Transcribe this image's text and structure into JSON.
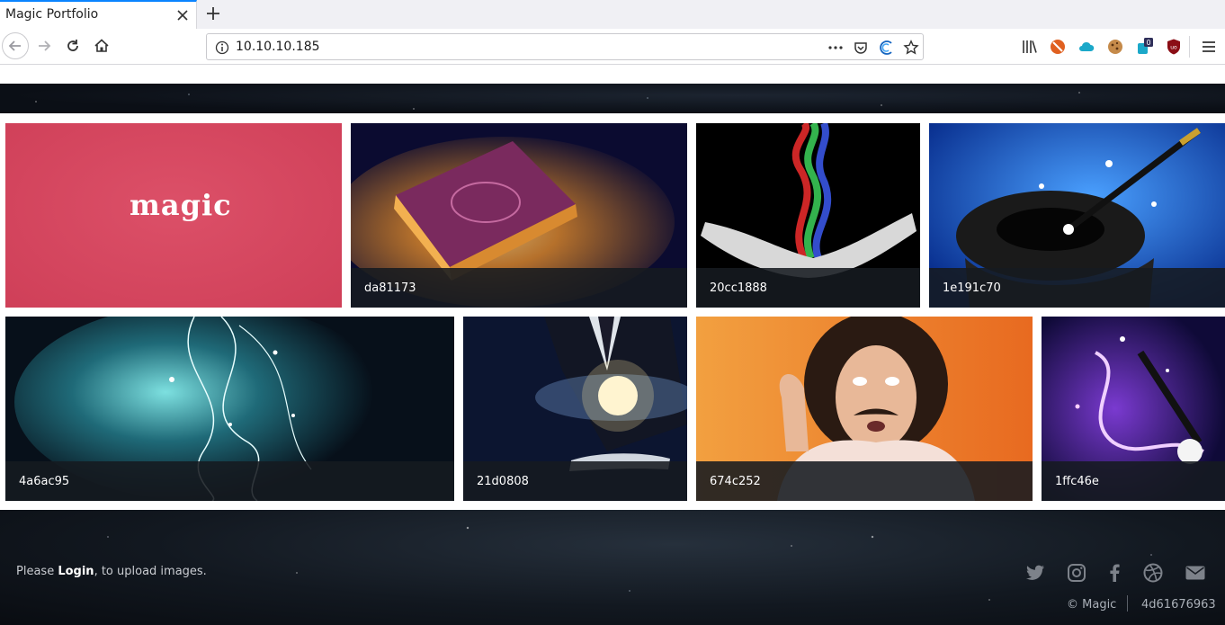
{
  "browser": {
    "tab_title": "Magic Portfolio",
    "url": "10.10.10.185",
    "notification_badge": "0"
  },
  "gallery": {
    "logo_text": "magic",
    "tiles": [
      {
        "caption": "da81173",
        "art": "glowing-book"
      },
      {
        "caption": "20cc1888",
        "art": "hand-with-rainbow-smoke"
      },
      {
        "caption": "1e191c70",
        "art": "top-hat-and-wand"
      },
      {
        "caption": "4a6ac95",
        "art": "teal-sparkle-swirls"
      },
      {
        "caption": "21d0808",
        "art": "galaxy-in-hand"
      },
      {
        "caption": "674c252",
        "art": "surprised-man"
      },
      {
        "caption": "1ffc46e",
        "art": "wand-purple-sparkles"
      }
    ]
  },
  "footer": {
    "pre_login": "Please ",
    "login_label": "Login",
    "post_login": ", to upload images.",
    "copyright": "© Magic",
    "hash": "4d61676963",
    "social": [
      "twitter-icon",
      "instagram-icon",
      "facebook-icon",
      "dribbble-icon",
      "email-icon"
    ]
  },
  "colors": {
    "accent": "#0a84ff",
    "logo_tile": "#d5455e",
    "caption_bar": "#161a20"
  }
}
